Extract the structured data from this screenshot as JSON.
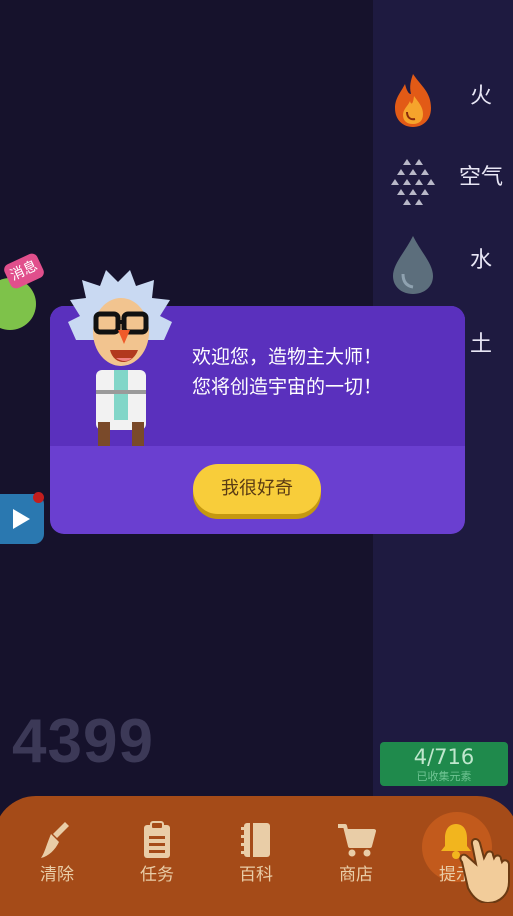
{
  "elements": [
    {
      "label": "火",
      "icon": "fire-icon"
    },
    {
      "label": "空气",
      "icon": "air-icon"
    },
    {
      "label": "水",
      "icon": "water-drop-icon"
    },
    {
      "label": "土",
      "icon": "earth-icon"
    }
  ],
  "message_badge": "消息",
  "watermark": "4399",
  "progress": {
    "count": "4/716",
    "caption": "已收集元素"
  },
  "dialog": {
    "line1": "欢迎您，造物主大师！",
    "line2": "您将创造宇宙的一切！",
    "button": "我很好奇"
  },
  "nav": [
    {
      "label": "清除",
      "icon": "broom-icon"
    },
    {
      "label": "任务",
      "icon": "clipboard-icon"
    },
    {
      "label": "百科",
      "icon": "book-icon"
    },
    {
      "label": "商店",
      "icon": "cart-icon"
    },
    {
      "label": "提示",
      "icon": "bell-icon"
    }
  ],
  "colors": {
    "background": "#16122c",
    "side_panel": "#1e1a40",
    "dialog": "#6a3fd0",
    "button": "#f8cd3a",
    "bottom_bar": "#a54b18",
    "progress": "#1f8a4c"
  }
}
